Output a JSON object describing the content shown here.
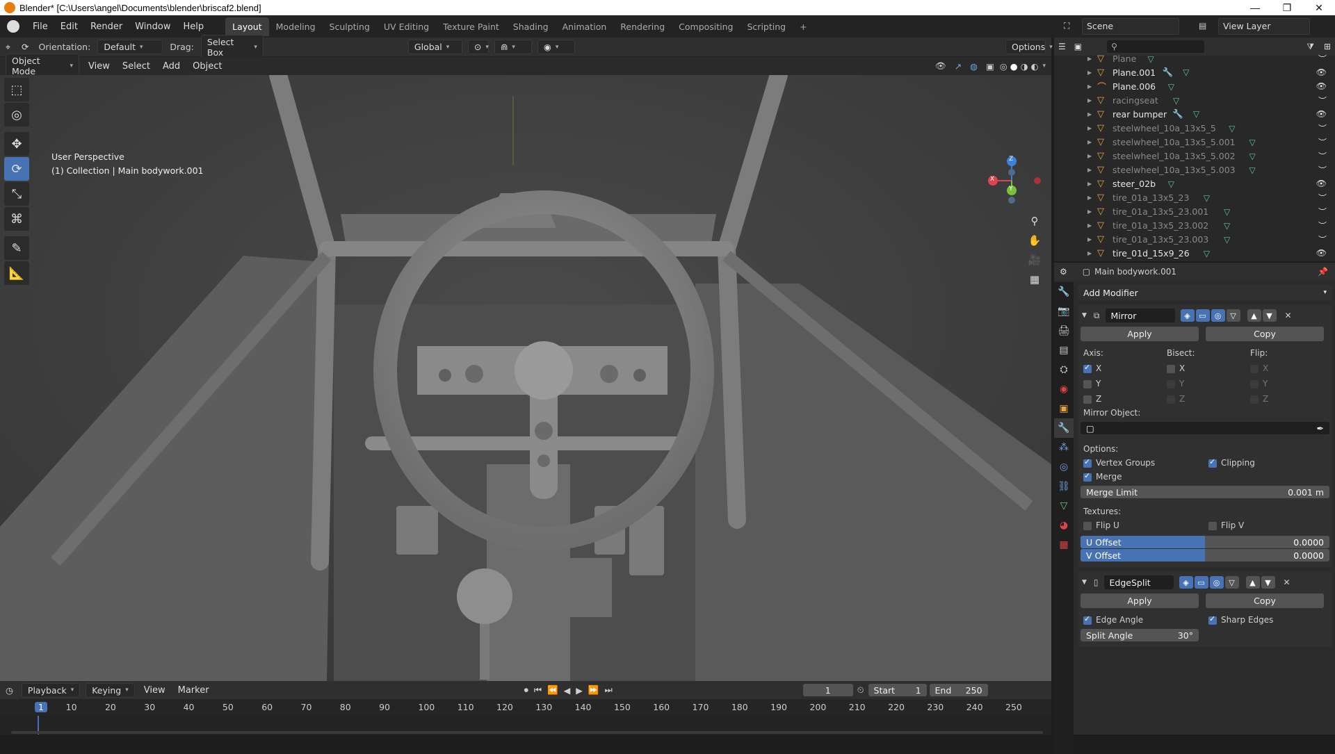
{
  "window": {
    "title": "Blender* [C:\\Users\\angel\\Documents\\blender\\briscaf2.blend]",
    "minimize": "—",
    "maximize": "❐",
    "close": "✕"
  },
  "menu": [
    "File",
    "Edit",
    "Render",
    "Window",
    "Help"
  ],
  "workspaces": [
    "Layout",
    "Modeling",
    "Sculpting",
    "UV Editing",
    "Texture Paint",
    "Shading",
    "Animation",
    "Rendering",
    "Compositing",
    "Scripting",
    "+"
  ],
  "scene": {
    "name": "Scene",
    "view_layer": "View Layer"
  },
  "header": {
    "orientation_label": "Orientation:",
    "orientation_value": "Default",
    "drag_label": "Drag:",
    "drag_value": "Select Box",
    "transform": "Global",
    "options": "Options"
  },
  "viewport_header": {
    "mode": "Object Mode",
    "menus": [
      "View",
      "Select",
      "Add",
      "Object"
    ]
  },
  "viewport": {
    "perspective": "User Perspective",
    "collection": "(1) Collection | Main bodywork.001",
    "gizmo": {
      "x": "X",
      "y": "Y",
      "z": "Z"
    }
  },
  "timeline": {
    "menus": [
      "Playback",
      "Keying",
      "View",
      "Marker"
    ],
    "current_frame": "1",
    "start_label": "Start",
    "start": "1",
    "end_label": "End",
    "end": "250",
    "ticks": [
      "1",
      "10",
      "20",
      "30",
      "40",
      "50",
      "60",
      "70",
      "80",
      "90",
      "100",
      "110",
      "120",
      "130",
      "140",
      "150",
      "160",
      "170",
      "180",
      "190",
      "200",
      "210",
      "220",
      "230",
      "240",
      "250"
    ]
  },
  "outliner": {
    "items": [
      {
        "name": "Plane",
        "dim": true,
        "type": "mesh"
      },
      {
        "name": "Plane.001",
        "dim": false,
        "type": "mesh",
        "mod": true
      },
      {
        "name": "Plane.006",
        "dim": false,
        "type": "curve"
      },
      {
        "name": "racingseat",
        "dim": true,
        "type": "mesh"
      },
      {
        "name": "rear bumper",
        "dim": false,
        "type": "mesh",
        "mod": true
      },
      {
        "name": "steelwheel_10a_13x5_5",
        "dim": true,
        "type": "mesh"
      },
      {
        "name": "steelwheel_10a_13x5_5.001",
        "dim": true,
        "type": "mesh"
      },
      {
        "name": "steelwheel_10a_13x5_5.002",
        "dim": true,
        "type": "mesh"
      },
      {
        "name": "steelwheel_10a_13x5_5.003",
        "dim": true,
        "type": "mesh"
      },
      {
        "name": "steer_02b",
        "dim": false,
        "type": "mesh"
      },
      {
        "name": "tire_01a_13x5_23",
        "dim": true,
        "type": "mesh"
      },
      {
        "name": "tire_01a_13x5_23.001",
        "dim": true,
        "type": "mesh"
      },
      {
        "name": "tire_01a_13x5_23.002",
        "dim": true,
        "type": "mesh"
      },
      {
        "name": "tire_01a_13x5_23.003",
        "dim": true,
        "type": "mesh"
      },
      {
        "name": "tire_01d_15x9_26",
        "dim": false,
        "type": "mesh"
      }
    ]
  },
  "properties": {
    "object": "Main bodywork.001",
    "add_modifier": "Add Modifier",
    "mirror": {
      "name": "Mirror",
      "apply": "Apply",
      "copy": "Copy",
      "axis": "Axis:",
      "bisect": "Bisect:",
      "flip": "Flip:",
      "x": "X",
      "y": "Y",
      "z": "Z",
      "mirror_object": "Mirror Object:",
      "options": "Options:",
      "vertex_groups": "Vertex Groups",
      "clipping": "Clipping",
      "merge": "Merge",
      "merge_limit": "Merge Limit",
      "merge_limit_value": "0.001 m",
      "textures": "Textures:",
      "flip_u": "Flip U",
      "flip_v": "Flip V",
      "u_offset": "U Offset",
      "u_offset_value": "0.0000",
      "v_offset": "V Offset",
      "v_offset_value": "0.0000",
      "offset_fill": 0.5
    },
    "edgesplit": {
      "name": "EdgeSplit",
      "apply": "Apply",
      "copy": "Copy",
      "edge_angle": "Edge Angle",
      "sharp_edges": "Sharp Edges",
      "split_angle": "Split Angle",
      "split_angle_value": "30°"
    }
  }
}
